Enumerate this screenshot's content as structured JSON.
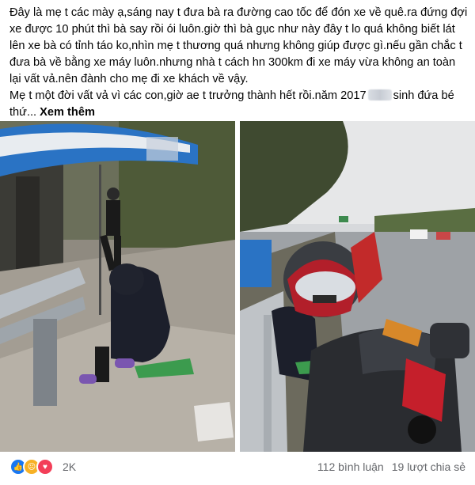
{
  "post": {
    "paragraph1": "Đây là mẹ t các mày ạ,sáng nay t đưa bà ra đường cao tốc để đón xe về quê.ra đứng đợi xe được 10 phút thì bà say rồi ói luôn.giờ thì bà gục như này đây t lo quá không biết lát lên xe bà có tỉnh táo ko,nhìn mẹ t thương quá nhưng không giúp được gì.nếu gần chắc t đưa bà về bằng xe máy luôn.nhưng nhà t cách hn 300km đi xe máy vừa không an toàn lại vất vả.nên đành cho mẹ đi xe khách về vậy.",
    "paragraph2_before": "Mẹ t một đời vất vả vì các con,giờ ae t trưởng thành hết rồi.năm 2017",
    "paragraph2_after": "sinh đứa bé thứ...",
    "see_more": "Xem thêm"
  },
  "footer": {
    "reaction_count": "2K",
    "reaction_icons": [
      "like-icon",
      "sad-icon",
      "love-icon"
    ],
    "comments": "112 bình luận",
    "shares": "19 lượt chia sẻ"
  },
  "colors": {
    "like": "#1877f2",
    "sad": "#f7b125",
    "love": "#f33e58",
    "umbrella": "#2a73c4",
    "jacket": "#1c1f2b",
    "helmet": "#b21f2a"
  }
}
